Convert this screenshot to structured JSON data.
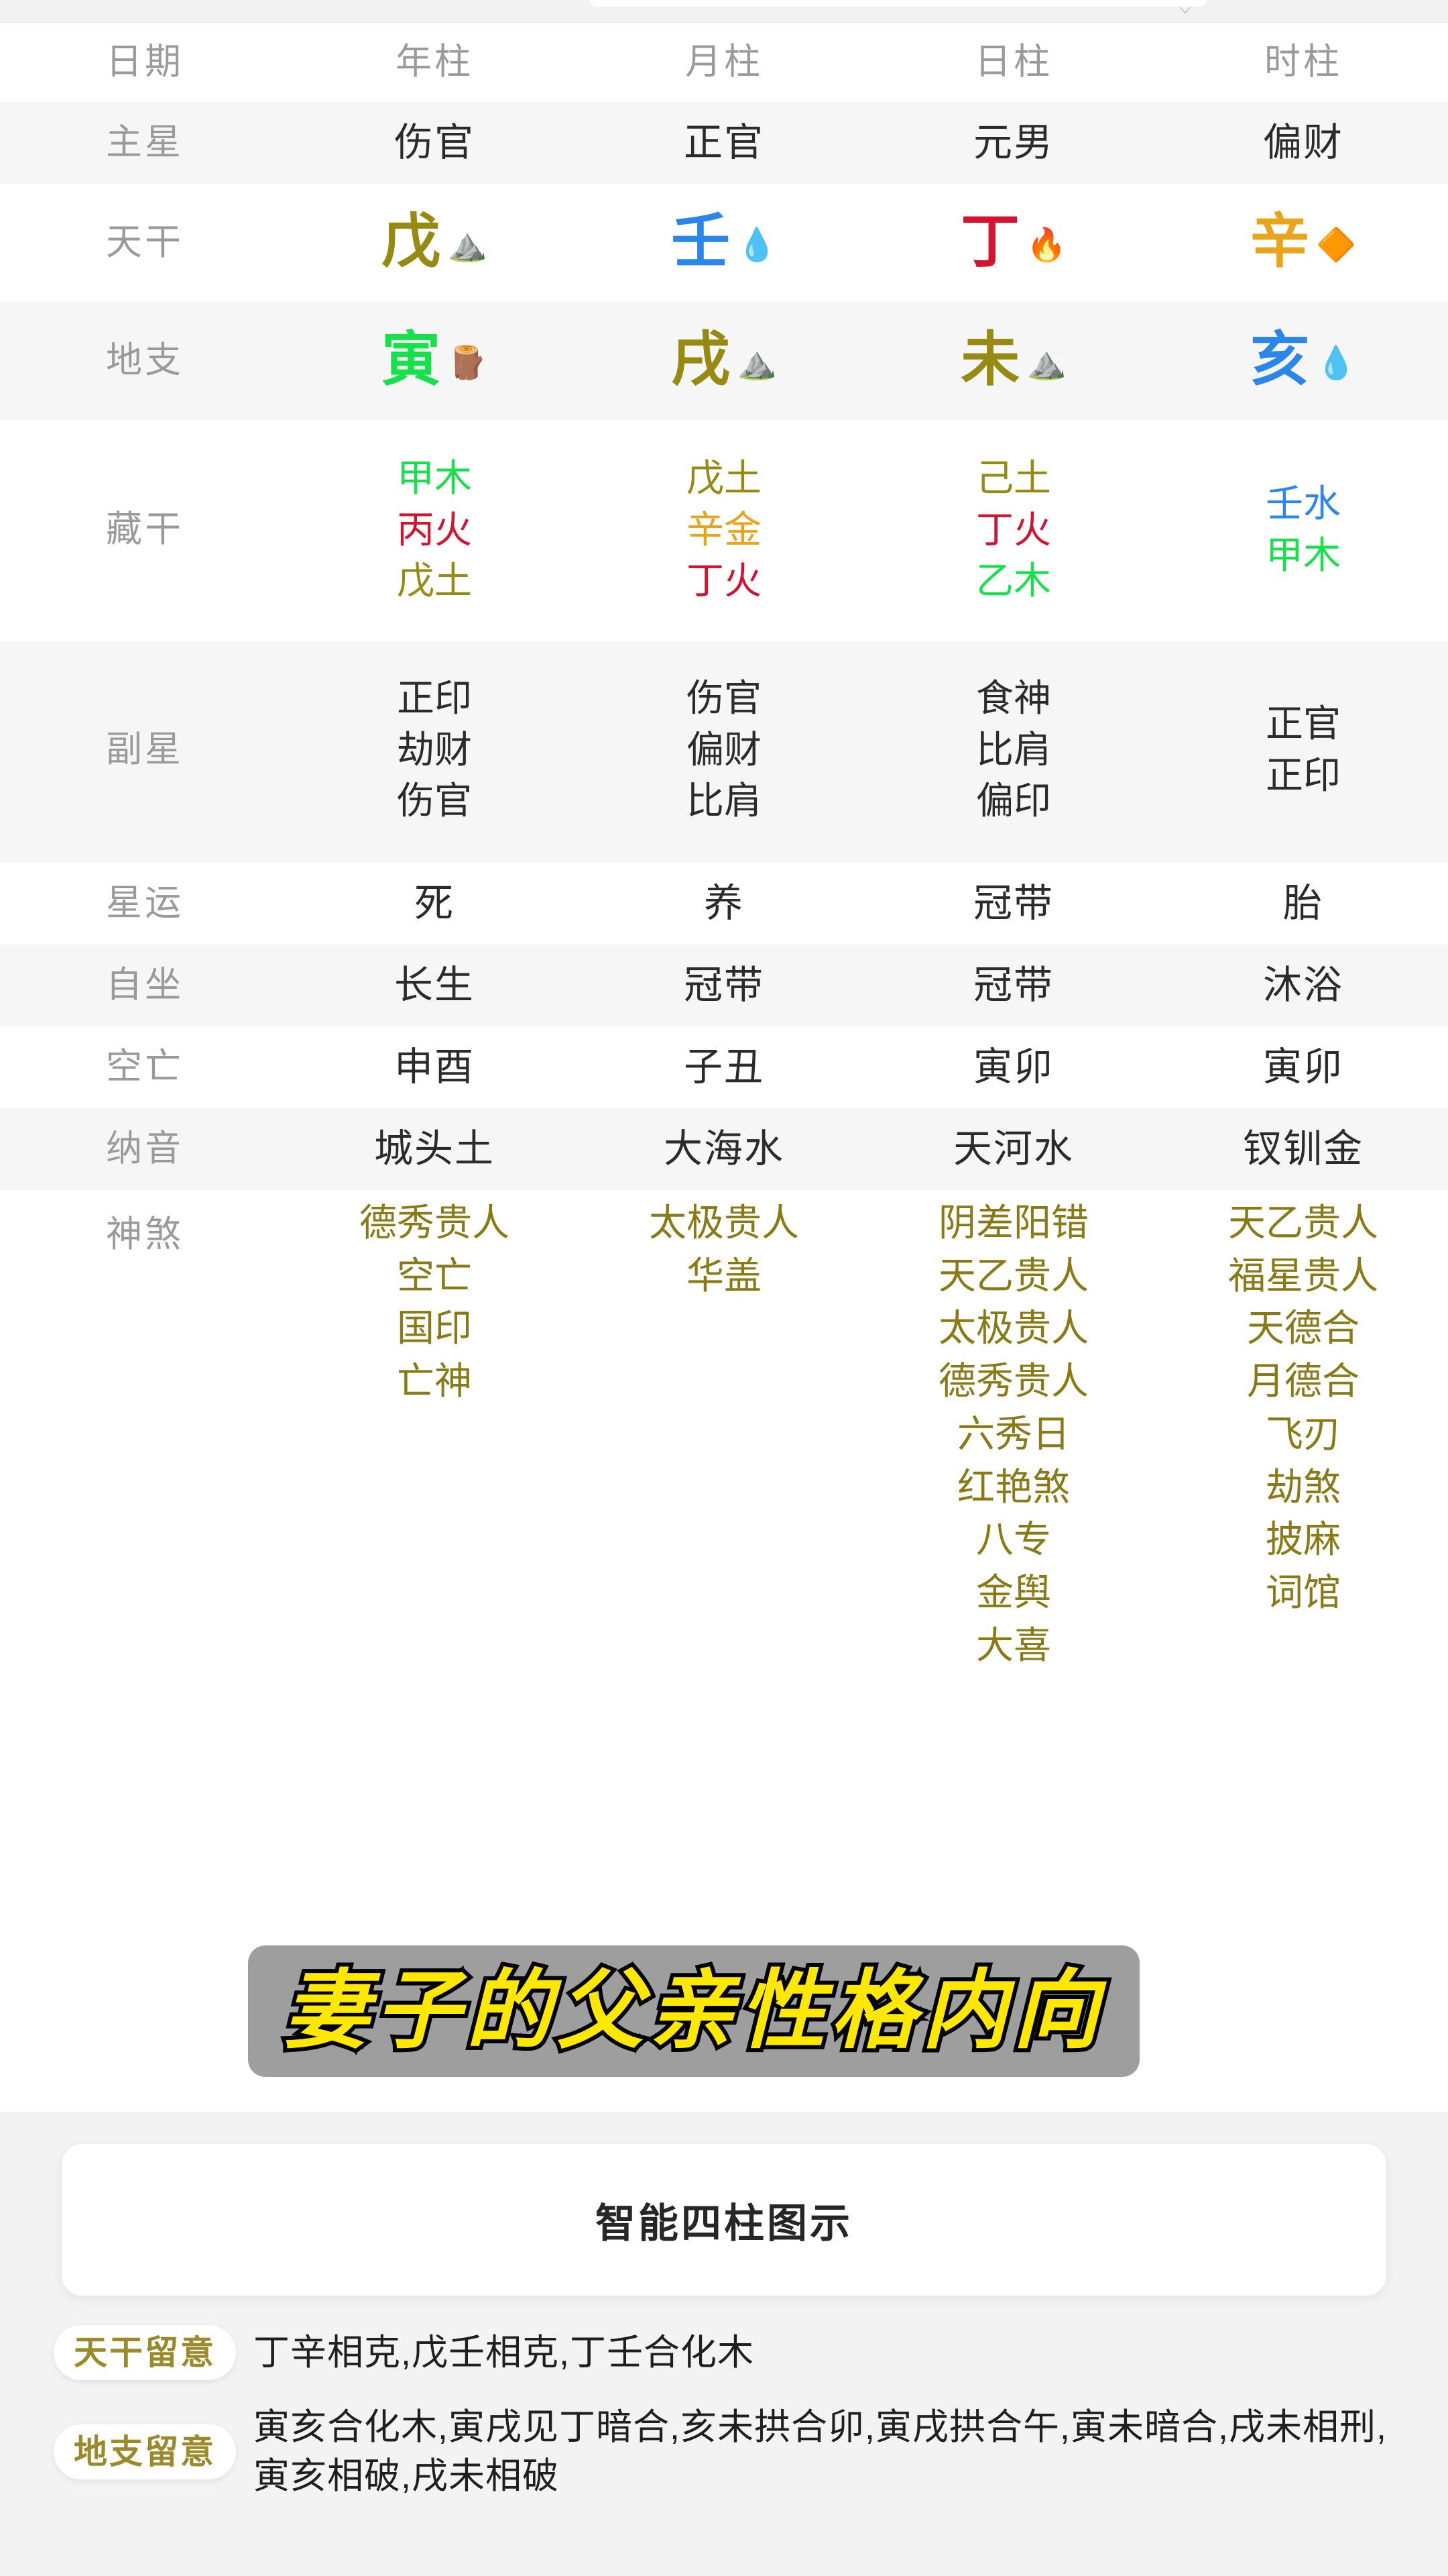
{
  "header": {
    "columns": [
      "日期",
      "年柱",
      "月柱",
      "日柱",
      "时柱"
    ]
  },
  "rows": {
    "zhuxing": {
      "label": "主星",
      "values": [
        "伤官",
        "正官",
        "元男",
        "偏财"
      ]
    },
    "tiangan": {
      "label": "天干",
      "values": [
        {
          "char": "戊",
          "emoji": "⛰️",
          "element": "earth",
          "icon": "mountain-icon"
        },
        {
          "char": "壬",
          "emoji": "💧",
          "element": "water",
          "icon": "droplet-icon"
        },
        {
          "char": "丁",
          "emoji": "🔥",
          "element": "fire",
          "icon": "fire-icon"
        },
        {
          "char": "辛",
          "emoji": "🔶",
          "element": "metal",
          "icon": "diamond-icon"
        }
      ]
    },
    "dizhi": {
      "label": "地支",
      "values": [
        {
          "char": "寅",
          "emoji": "🪵",
          "element": "wood",
          "icon": "wood-log-icon"
        },
        {
          "char": "戌",
          "emoji": "⛰️",
          "element": "earth",
          "icon": "mountain-icon"
        },
        {
          "char": "未",
          "emoji": "⛰️",
          "element": "earth",
          "icon": "mountain-icon"
        },
        {
          "char": "亥",
          "emoji": "💧",
          "element": "water",
          "icon": "droplet-icon"
        }
      ]
    },
    "canggan": {
      "label": "藏干",
      "columns": [
        [
          {
            "text": "甲木",
            "element": "wood"
          },
          {
            "text": "丙火",
            "element": "fire"
          },
          {
            "text": "戊土",
            "element": "earth"
          }
        ],
        [
          {
            "text": "戊土",
            "element": "earth"
          },
          {
            "text": "辛金",
            "element": "metal"
          },
          {
            "text": "丁火",
            "element": "fire"
          }
        ],
        [
          {
            "text": "己土",
            "element": "earth"
          },
          {
            "text": "丁火",
            "element": "fire"
          },
          {
            "text": "乙木",
            "element": "wood"
          }
        ],
        [
          {
            "text": "壬水",
            "element": "water"
          },
          {
            "text": "甲木",
            "element": "wood"
          }
        ]
      ]
    },
    "fuxing": {
      "label": "副星",
      "columns": [
        [
          "正印",
          "劫财",
          "伤官"
        ],
        [
          "伤官",
          "偏财",
          "比肩"
        ],
        [
          "食神",
          "比肩",
          "偏印"
        ],
        [
          "正官",
          "正印"
        ]
      ]
    },
    "xingyun": {
      "label": "星运",
      "values": [
        "死",
        "养",
        "冠带",
        "胎"
      ]
    },
    "zizuo": {
      "label": "自坐",
      "values": [
        "长生",
        "冠带",
        "冠带",
        "沐浴"
      ]
    },
    "kongwang": {
      "label": "空亡",
      "values": [
        "申酉",
        "子丑",
        "寅卯",
        "寅卯"
      ]
    },
    "nayin": {
      "label": "纳音",
      "values": [
        "城头土",
        "大海水",
        "天河水",
        "钗钏金"
      ]
    },
    "shensha": {
      "label": "神煞",
      "columns": [
        [
          "德秀贵人",
          "空亡",
          "国印",
          "亡神"
        ],
        [
          "太极贵人",
          "华盖"
        ],
        [
          "阴差阳错",
          "天乙贵人",
          "太极贵人",
          "德秀贵人",
          "六秀日",
          "红艳煞",
          "八专",
          "金舆",
          "大喜"
        ],
        [
          "天乙贵人",
          "福星贵人",
          "天德合",
          "月德合",
          "飞刃",
          "劫煞",
          "披麻",
          "词馆"
        ]
      ]
    }
  },
  "subtitle": {
    "text": "妻子的父亲性格内向"
  },
  "bottom": {
    "card_title": "智能四柱图示",
    "notes": [
      {
        "chip": "天干留意",
        "text": "丁辛相克,戊壬相克,丁壬合化木"
      },
      {
        "chip": "地支留意",
        "text": "寅亥合化木,寅戌见丁暗合,亥未拱合卯,寅戌拱合午,寅未暗合,戌未相刑,寅亥相破,戌未相破"
      }
    ]
  },
  "colors": {
    "wood": "#16e04a",
    "fire": "#d01431",
    "earth": "#968a12",
    "metal": "#e8a41b",
    "water": "#2a86e8",
    "shensha": "#8a7a16",
    "label": "#9a9a9a",
    "subtitle_fill": "#ffe800",
    "subtitle_bg": "#9e9e9e",
    "chip_text": "#9a8a2a"
  }
}
